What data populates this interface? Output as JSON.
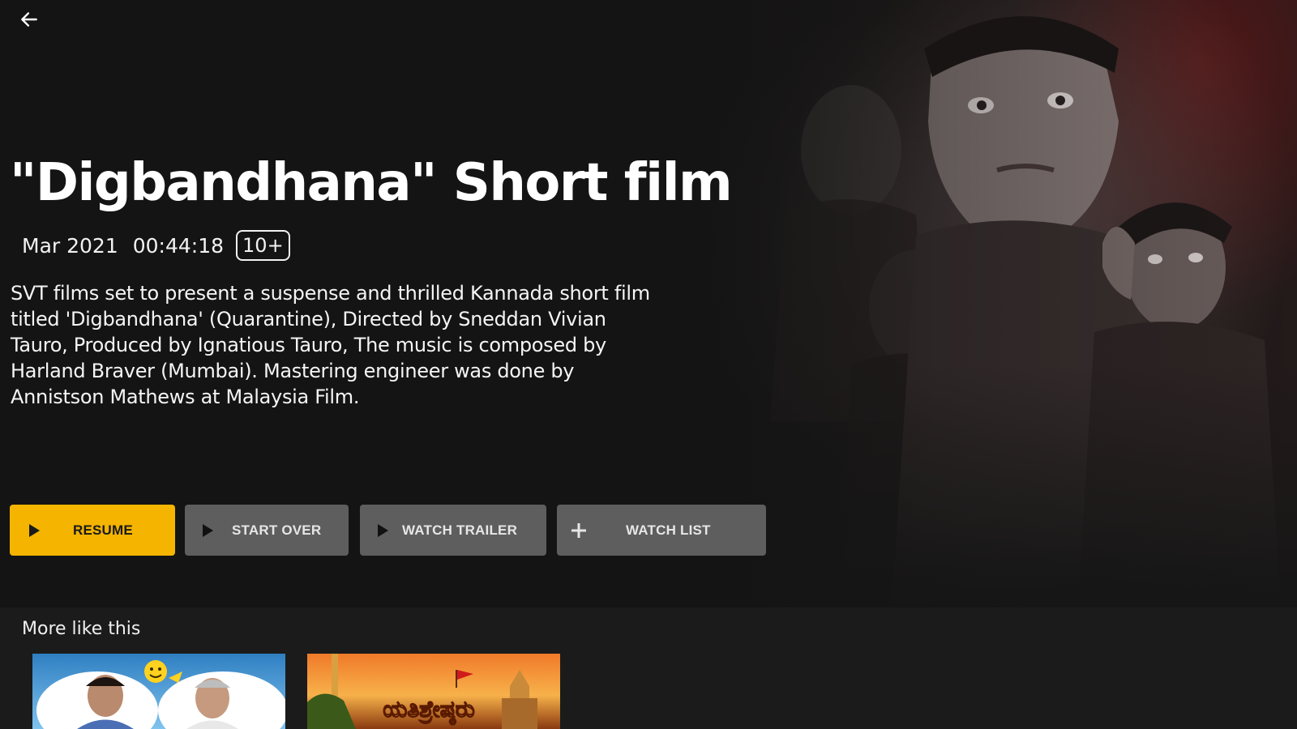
{
  "nav": {
    "back_icon": "arrow-left-icon"
  },
  "movie": {
    "title": "\"Digbandhana\" Short film",
    "date": "Mar 2021",
    "duration": "00:44:18",
    "rating": "10+",
    "description": "SVT films set to present a suspense and thrilled Kannada short film titled 'Digbandhana' (Quarantine), Directed  by Sneddan Vivian Tauro, Produced by Ignatious Tauro, The music is composed by Harland Braver (Mumbai). Mastering engineer was done by Annistson Mathews at Malaysia Film."
  },
  "actions": {
    "resume": {
      "label": "RESUME",
      "icon": "play-icon"
    },
    "start_over": {
      "label": "START OVER",
      "icon": "play-icon"
    },
    "watch_trailer": {
      "label": "WATCH TRAILER",
      "icon": "play-icon"
    },
    "watch_list": {
      "label": "WATCH LIST",
      "icon": "plus-icon"
    }
  },
  "more_like_this": {
    "heading": "More like this",
    "items": [
      {
        "thumbnail": "comedy-poster"
      },
      {
        "thumbnail": "yathishreshtaru-poster",
        "title_art": "ಯತಿಶ್ರೇಷ್ಠರು"
      }
    ]
  },
  "colors": {
    "background": "#161616",
    "accent": "#f4b400",
    "secondary_button": "#5e5e5e",
    "text": "#ffffff"
  }
}
